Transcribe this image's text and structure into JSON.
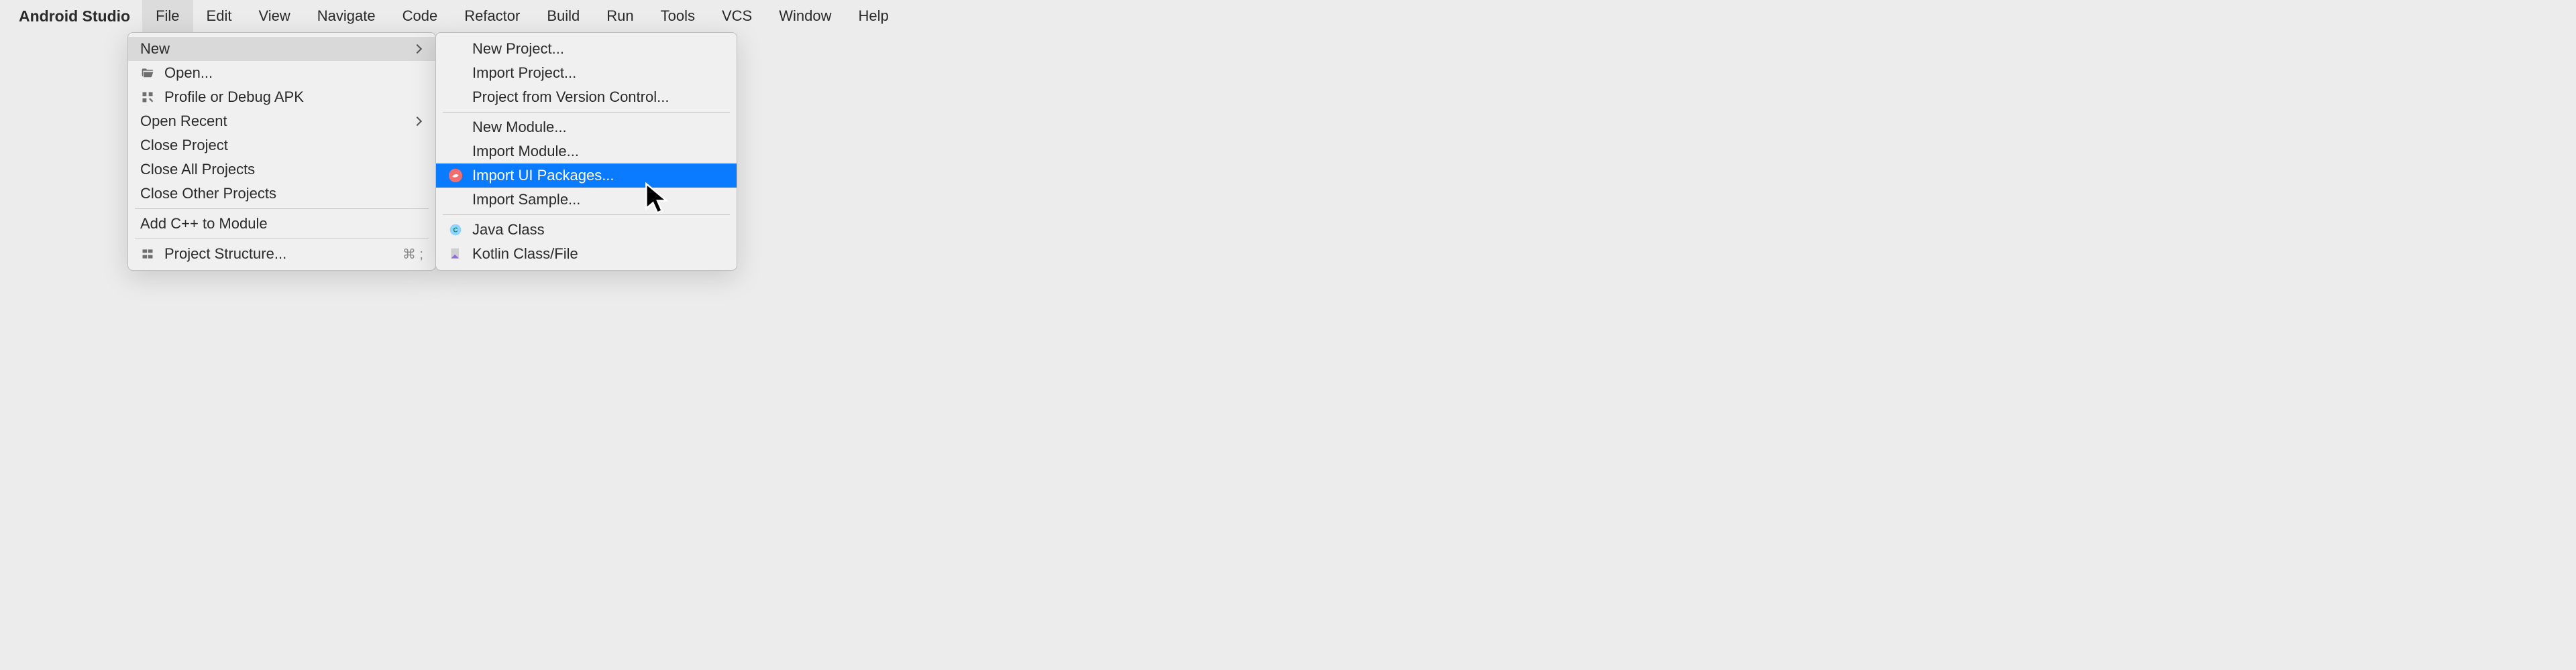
{
  "app": {
    "name": "Android Studio"
  },
  "menubar": {
    "items": [
      {
        "label": "File",
        "active": true
      },
      {
        "label": "Edit"
      },
      {
        "label": "View"
      },
      {
        "label": "Navigate"
      },
      {
        "label": "Code"
      },
      {
        "label": "Refactor"
      },
      {
        "label": "Build"
      },
      {
        "label": "Run"
      },
      {
        "label": "Tools"
      },
      {
        "label": "VCS"
      },
      {
        "label": "Window"
      },
      {
        "label": "Help"
      }
    ]
  },
  "fileMenu": {
    "new": "New",
    "open": "Open...",
    "profile": "Profile or Debug APK",
    "openRecent": "Open Recent",
    "closeProject": "Close Project",
    "closeAll": "Close All Projects",
    "closeOther": "Close Other Projects",
    "addCpp": "Add C++ to Module",
    "projectStructure": "Project Structure...",
    "projectStructureShortcut": "⌘ ;"
  },
  "newSubmenu": {
    "newProject": "New Project...",
    "importProject": "Import Project...",
    "fromVC": "Project from Version Control...",
    "newModule": "New Module...",
    "importModule": "Import Module...",
    "importUI": "Import UI Packages...",
    "importSample": "Import Sample...",
    "javaClass": "Java Class",
    "kotlinClass": "Kotlin Class/File"
  }
}
